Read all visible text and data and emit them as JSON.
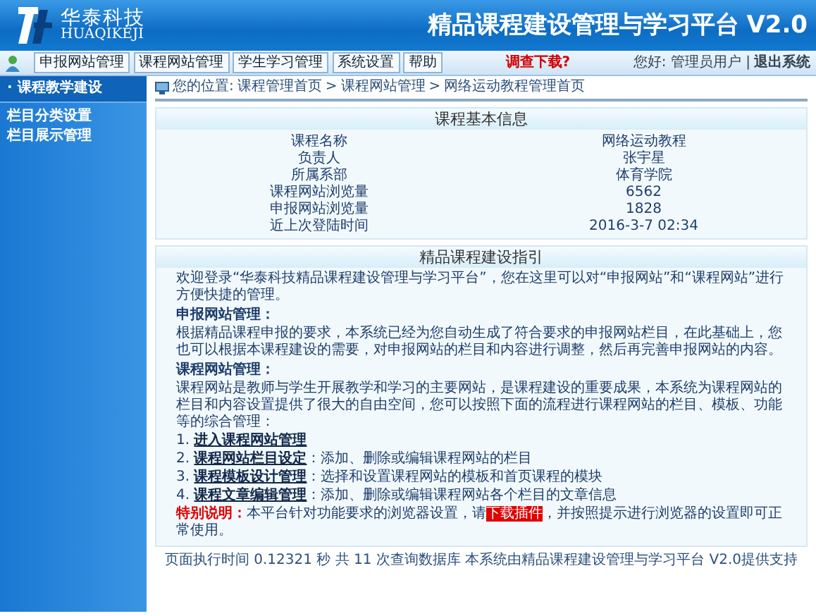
{
  "header": {
    "logo_text": "华泰科技",
    "logo_subtext": "HUAQIKEJI",
    "title": "精品课程建设管理与学习平台",
    "version": "V2.0"
  },
  "nav": {
    "buttons": [
      "申报网站管理",
      "课程网站管理",
      "学生学习管理",
      "系统设置",
      "帮助"
    ],
    "notice": "调查下载?",
    "user_text": "您好: 管理员用户 |",
    "logout": "退出系统"
  },
  "sidebar": {
    "title": "· 课程教学建设",
    "items": [
      "栏目分类设置",
      "栏目展示管理"
    ]
  },
  "breadcrumb": {
    "label": "您的位置:",
    "links": [
      "课程管理首页",
      "课程网站管理",
      "网络运动教程管理首页"
    ],
    "separator": ">"
  },
  "course_info": {
    "title": "课程基本信息",
    "rows": [
      {
        "label": "课程名称",
        "value": "网络运动教程"
      },
      {
        "label": "负责人",
        "value": "张宇星"
      },
      {
        "label": "所属系部",
        "value": "体育学院"
      },
      {
        "label": "课程网站浏览量",
        "value": "6562"
      },
      {
        "label": "申报网站浏览量",
        "value": "1828"
      },
      {
        "label": "近上次登陆时间",
        "value": "2016-3-7 02:34"
      }
    ]
  },
  "guide": {
    "title": "精品课程建设指引",
    "intro": "欢迎登录“华泰科技精品课程建设管理与学习平台”，您在这里可以对“申报网站”和“课程网站”进行方便快捷的管理。",
    "sections": [
      {
        "heading": "申报网站管理：",
        "text": "根据精品课程申报的要求，本系统已经为您自动生成了符合要求的申报网站栏目，在此基础上，您也可以根据本课程建设的需要，对申报网站的栏目和内容进行调整，然后再完善申报网站的内容。"
      },
      {
        "heading": "课程网站管理：",
        "text": "课程网站是教师与学生开展教学和学习的主要网站，是课程建设的重要成果，本系统为课程网站的栏目和内容设置提供了很大的自由空间，您可以按照下面的流程进行课程网站的栏目、模板、功能等的综合管理："
      }
    ],
    "steps": [
      {
        "number": "1.",
        "link": "进入课程网站管理"
      },
      {
        "number": "2.",
        "link": "课程网站栏目设定",
        "text": "：添加、删除或编辑课程网站的栏目"
      },
      {
        "number": "3.",
        "link": "课程模板设计管理",
        "text": "：选择和设置课程网站的模板和首页课程的模块"
      },
      {
        "number": "4.",
        "link": "课程文章编辑管理",
        "text": "：添加、删除或编辑课程网站各个栏目的文章信息"
      }
    ],
    "note": {
      "label": "特别说明：",
      "before": "本平台针对功能要求的浏览器设置，请",
      "link": "下载插件",
      "after": "，并按照提示进行浏览器的设置即可正常使用。"
    }
  },
  "footer": "页面执行时间 0.12321 秒 共 11 次查询数据库 本系统由精品课程建设管理与学习平台 V2.0提供支持"
}
